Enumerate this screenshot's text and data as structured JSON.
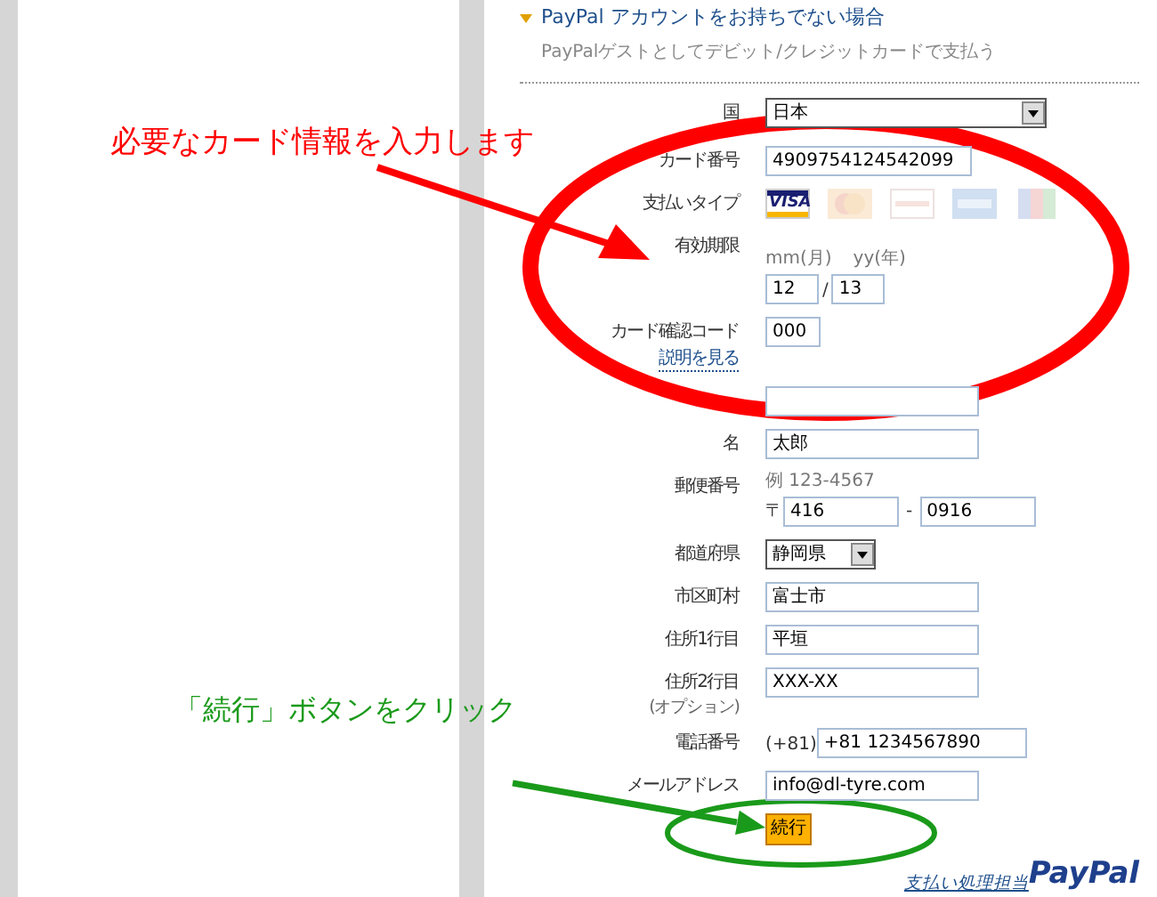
{
  "header": {
    "title": "PayPal アカウントをお持ちでない場合",
    "subtitle": "PayPalゲストとしてデビット/クレジットカードで支払う"
  },
  "form": {
    "fields": [
      {
        "kind": "select",
        "label": "国",
        "value": "日本"
      },
      {
        "kind": "text",
        "label": "カード番号",
        "value": "4909754124542099"
      },
      {
        "kind": "cards",
        "label": "支払いタイプ",
        "cards": [
          {
            "kind": "visa",
            "label": "VISA",
            "selected": true
          },
          {
            "kind": "mastercard",
            "selected": false
          },
          {
            "kind": "discover",
            "selected": false
          },
          {
            "kind": "amex",
            "selected": false
          },
          {
            "kind": "jcb",
            "selected": false
          }
        ]
      },
      {
        "kind": "expiry",
        "label": "有効期限",
        "month_caption": "mm(月)",
        "year_caption": "yy(年)",
        "month": "12",
        "separator": "/",
        "year": "13"
      },
      {
        "kind": "cvv",
        "label": "カード確認コード",
        "link": "説明を見る",
        "value": "000"
      },
      {
        "kind": "text"
      },
      {
        "kind": "text",
        "label": "名",
        "value": "太郎"
      },
      {
        "kind": "postal",
        "label": "郵便番号",
        "example": "例 123-4567",
        "prefix": "〒",
        "first": "416",
        "separator": "-",
        "second": "0916"
      },
      {
        "kind": "select",
        "label": "都道府県",
        "value": "静岡県"
      },
      {
        "kind": "text",
        "label": "市区町村",
        "value": "富士市"
      },
      {
        "kind": "text",
        "label": "住所1行目",
        "value": "平垣"
      },
      {
        "kind": "text",
        "label": "住所2行目",
        "note": "(オプション)",
        "value": "XXX-XX"
      },
      {
        "kind": "phone",
        "label": "電話番号",
        "prefix": "(+81)",
        "value": "+81 1234567890"
      },
      {
        "kind": "text",
        "label": "メールアドレス",
        "value": "info@dl-tyre.com"
      }
    ],
    "submit": "続行"
  },
  "footer": {
    "caption": "支払い処理担当",
    "brand": "PayPal"
  },
  "annotations": [
    {
      "kind": "card-info",
      "text": "必要なカード情報を入力します",
      "color": "#ff0000"
    },
    {
      "kind": "submit",
      "text": "「続行」ボタンをクリック",
      "color": "#1a9a1a"
    }
  ]
}
